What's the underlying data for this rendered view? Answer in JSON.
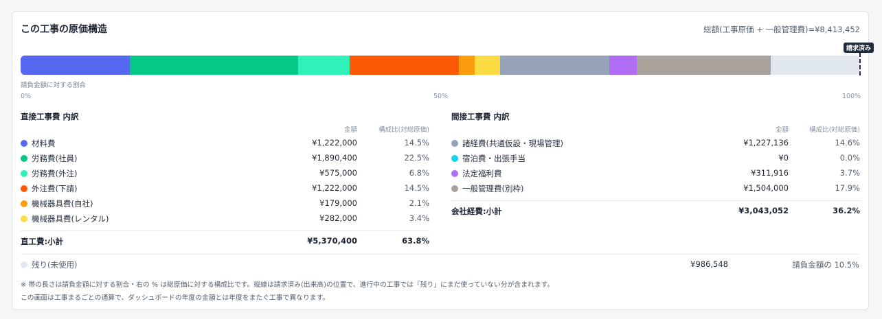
{
  "card": {
    "title": "この工事の原価構造",
    "total_label": "総額(工事原価 + 一般管理費)=¥8,413,452",
    "billed_tag": "請求済み",
    "bar_caption": "請負金額に対する割合",
    "axis": {
      "start": "0%",
      "mid": "50%",
      "end": "100%"
    }
  },
  "bar_segments": [
    {
      "name": "材料費",
      "percent_of_contract": 13.0,
      "color": "#5468f2"
    },
    {
      "name": "労務費(社員)",
      "percent_of_contract": 20.1,
      "color": "#05c886"
    },
    {
      "name": "労務費(外注)",
      "percent_of_contract": 6.1,
      "color": "#2ef2b8"
    },
    {
      "name": "外注費(下請)",
      "percent_of_contract": 13.0,
      "color": "#fe5a05"
    },
    {
      "name": "機械器具費(自社)",
      "percent_of_contract": 1.9,
      "color": "#fd9d0c"
    },
    {
      "name": "機械器具費(レンタル)",
      "percent_of_contract": 3.0,
      "color": "#fcdb45"
    },
    {
      "name": "諸経費(共通仮設・現場管理)",
      "percent_of_contract": 13.0,
      "color": "#95a2b8"
    },
    {
      "name": "法定福利費",
      "percent_of_contract": 3.3,
      "color": "#b06cf2"
    },
    {
      "name": "一般管理費(別枠)",
      "percent_of_contract": 16.0,
      "color": "#a8a29d"
    },
    {
      "name": "残り(未使用)",
      "percent_of_contract": 10.5,
      "color": "#e3e8ef"
    }
  ],
  "billed_position_percent": 99.8,
  "direct": {
    "title": "直接工事費 内訳",
    "col_amount": "金額",
    "col_ratio": "構成比(対総原価)",
    "rows": [
      {
        "label": "材料費",
        "amount": "¥1,222,000",
        "ratio": "14.5%",
        "color": "#5468f2"
      },
      {
        "label": "労務費(社員)",
        "amount": "¥1,890,400",
        "ratio": "22.5%",
        "color": "#05c886"
      },
      {
        "label": "労務費(外注)",
        "amount": "¥575,000",
        "ratio": "6.8%",
        "color": "#2ef2b8"
      },
      {
        "label": "外注費(下請)",
        "amount": "¥1,222,000",
        "ratio": "14.5%",
        "color": "#fe5a05"
      },
      {
        "label": "機械器具費(自社)",
        "amount": "¥179,000",
        "ratio": "2.1%",
        "color": "#fd9d0c"
      },
      {
        "label": "機械器具費(レンタル)",
        "amount": "¥282,000",
        "ratio": "3.4%",
        "color": "#fcdb45"
      }
    ],
    "subtotal": {
      "label": "直工費:小計",
      "amount": "¥5,370,400",
      "ratio": "63.8%"
    }
  },
  "indirect": {
    "title": "間接工事費 内訳",
    "col_amount": "金額",
    "col_ratio": "構成比(対総原価)",
    "rows": [
      {
        "label": "諸経費(共通仮設・現場管理)",
        "amount": "¥1,227,136",
        "ratio": "14.6%",
        "color": "#95a2b8"
      },
      {
        "label": "宿泊費・出張手当",
        "amount": "¥0",
        "ratio": "0.0%",
        "color": "#13d3ea"
      },
      {
        "label": "法定福利費",
        "amount": "¥311,916",
        "ratio": "3.7%",
        "color": "#b06cf2"
      },
      {
        "label": "一般管理費(別枠)",
        "amount": "¥1,504,000",
        "ratio": "17.9%",
        "color": "#a8a29d"
      }
    ],
    "subtotal": {
      "label": "会社経費:小計",
      "amount": "¥3,043,052",
      "ratio": "36.2%"
    }
  },
  "remaining": {
    "label": "残り(未使用)",
    "amount": "¥986,548",
    "ratio": "請負金額の 10.5%",
    "color": "#e3e8ef"
  },
  "notes": [
    "※ 帯の長さは請負金額に対する割合・右の % は総原価に対する構成比です。縦線は請求済み(出来高)の位置で、進行中の工事では「残り」にまだ使っていない分が含まれます。",
    "この画面は工事まるごとの通算で、ダッシュボードの年度の金額とは年度をまたぐ工事で異なります。"
  ]
}
